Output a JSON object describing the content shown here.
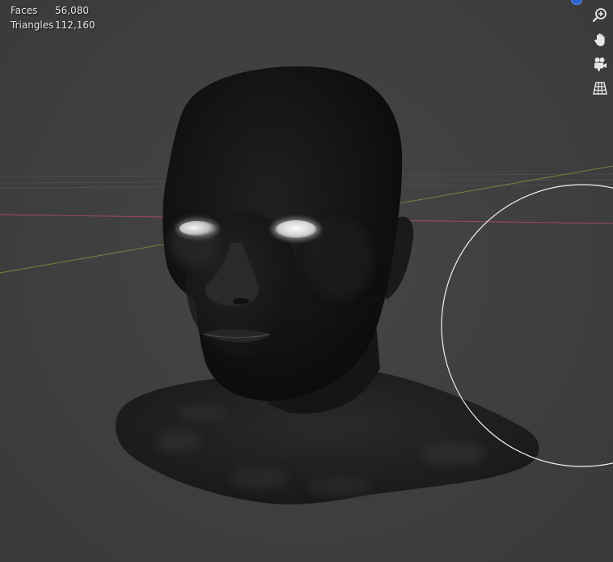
{
  "overlay": {
    "stats": [
      {
        "label": "Faces",
        "value": "56,080"
      },
      {
        "label": "Triangles",
        "value": "112,160"
      }
    ]
  },
  "navigation": {
    "buttons": [
      {
        "name": "zoom-icon"
      },
      {
        "name": "pan-hand-icon"
      },
      {
        "name": "camera-view-icon"
      },
      {
        "name": "perspective-grid-icon"
      }
    ]
  },
  "colors": {
    "background": "#3d3d3d",
    "x_axis": "#a04a57",
    "y_axis": "#6f8a3b",
    "brush_circle": "#f2f2f2",
    "gizmo_dot": "#2a62c9"
  }
}
